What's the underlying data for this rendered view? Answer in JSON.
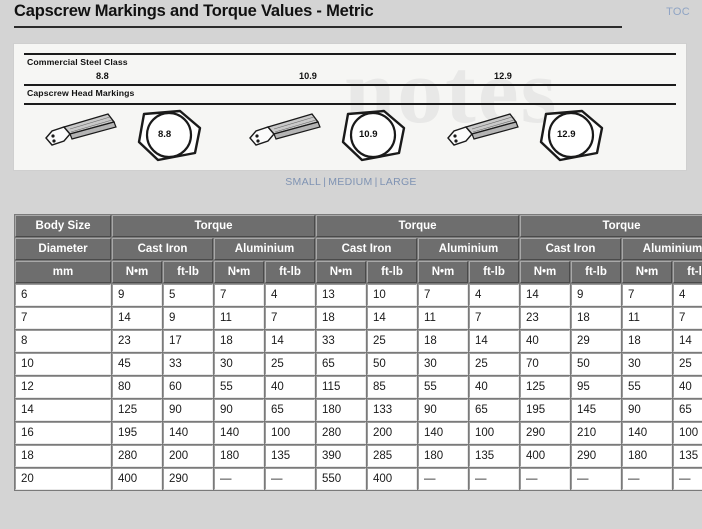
{
  "header": {
    "title": "Capscrew Markings and Torque Values - Metric",
    "toc_label": "TOC"
  },
  "figure": {
    "row1_label": "Commercial Steel Class",
    "row2_label": "Capscrew Head Markings",
    "classes": [
      "8.8",
      "10.9",
      "12.9"
    ],
    "watermark": "notes"
  },
  "size_links": {
    "items": [
      "SMALL",
      "MEDIUM",
      "LARGE"
    ],
    "separator": "|",
    "color": "#7f93b3"
  },
  "table": {
    "header_row1": [
      "Body Size",
      "Torque",
      "Torque",
      "Torque"
    ],
    "header_row2": [
      "Diameter",
      "Cast Iron",
      "Aluminium",
      "Cast Iron",
      "Aluminium",
      "Cast Iron",
      "Aluminium"
    ],
    "header_row3": [
      "mm",
      "N•m",
      "ft-lb",
      "N•m",
      "ft-lb",
      "N•m",
      "ft-lb",
      "N•m",
      "ft-lb",
      "N•m",
      "ft-lb",
      "N•m",
      "ft-lb"
    ],
    "rows": [
      {
        "cells": [
          "6",
          "9",
          "5",
          "7",
          "4",
          "13",
          "10",
          "7",
          "4",
          "14",
          "9",
          "7",
          "4"
        ]
      },
      {
        "cells": [
          "7",
          "14",
          "9",
          "11",
          "7",
          "18",
          "14",
          "11",
          "7",
          "23",
          "18",
          "11",
          "7"
        ]
      },
      {
        "cells": [
          "8",
          "23",
          "17",
          "18",
          "14",
          "33",
          "25",
          "18",
          "14",
          "40",
          "29",
          "18",
          "14"
        ]
      },
      {
        "cells": [
          "10",
          "45",
          "33",
          "30",
          "25",
          "65",
          "50",
          "30",
          "25",
          "70",
          "50",
          "30",
          "25"
        ]
      },
      {
        "cells": [
          "12",
          "80",
          "60",
          "55",
          "40",
          "115",
          "85",
          "55",
          "40",
          "125",
          "95",
          "55",
          "40"
        ]
      },
      {
        "cells": [
          "14",
          "125",
          "90",
          "90",
          "65",
          "180",
          "133",
          "90",
          "65",
          "195",
          "145",
          "90",
          "65"
        ]
      },
      {
        "cells": [
          "16",
          "195",
          "140",
          "140",
          "100",
          "280",
          "200",
          "140",
          "100",
          "290",
          "210",
          "140",
          "100"
        ]
      },
      {
        "cells": [
          "18",
          "280",
          "200",
          "180",
          "135",
          "390",
          "285",
          "180",
          "135",
          "400",
          "290",
          "180",
          "135"
        ]
      },
      {
        "cells": [
          "20",
          "400",
          "290",
          "—",
          "—",
          "550",
          "400",
          "—",
          "—",
          "—",
          "—",
          "—",
          "—"
        ]
      }
    ]
  },
  "colors": {
    "page_background": "#d4d4d4",
    "header_cell": "#6e6e6e",
    "link": "#7f93b3",
    "toc_link": "#8fa4c4"
  }
}
